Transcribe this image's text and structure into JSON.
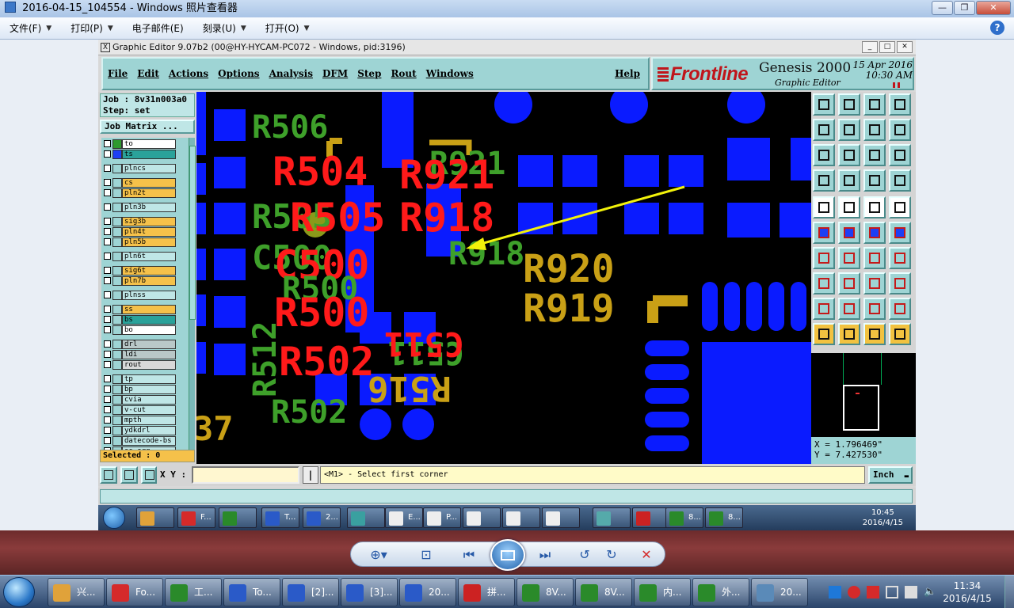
{
  "viewer": {
    "title": "2016-04-15_104554 - Windows 照片查看器",
    "menu": [
      {
        "label": "文件(F)"
      },
      {
        "label": "打印(P)"
      },
      {
        "label": "电子邮件(E)"
      },
      {
        "label": "刻录(U)"
      },
      {
        "label": "打开(O)"
      }
    ]
  },
  "editor": {
    "title": "Graphic Editor 9.07b2 (00@HY-HYCAM-PC072 - Windows, pid:3196)",
    "menu": [
      "File",
      "Edit",
      "Actions",
      "Options",
      "Analysis",
      "DFM",
      "Step",
      "Rout",
      "Windows"
    ],
    "help": "Help",
    "brand": {
      "logo": "Frontline",
      "product": "Genesis 2000",
      "subtitle": "Graphic Editor",
      "date": "15 Apr 2016",
      "time": "10:30 AM"
    },
    "job_line": "Job : 8v31n003a0",
    "step_line": "Step: set",
    "job_matrix": "Job Matrix ...",
    "layers": [
      {
        "name": "to",
        "swatch": "#2e9a2e",
        "bg": "#ffffff"
      },
      {
        "name": "ts",
        "swatch": "#1d3ff5",
        "bg": "#2aa29a"
      },
      {
        "name": "plncs",
        "swatch": "",
        "bg": "#bfe6e6"
      },
      {
        "name": "cs",
        "swatch": "",
        "bg": "#f5c14a"
      },
      {
        "name": "pln2t",
        "swatch": "",
        "bg": "#f5c14a"
      },
      {
        "name": "pln3b",
        "swatch": "",
        "bg": "#bfe6e6"
      },
      {
        "name": "sig3b",
        "swatch": "",
        "bg": "#f5c14a"
      },
      {
        "name": "pln4t",
        "swatch": "",
        "bg": "#f5c14a"
      },
      {
        "name": "pln5b",
        "swatch": "",
        "bg": "#f5c14a"
      },
      {
        "name": "pln6t",
        "swatch": "",
        "bg": "#bfe6e6"
      },
      {
        "name": "sig6t",
        "swatch": "",
        "bg": "#f5c14a"
      },
      {
        "name": "pln7b",
        "swatch": "",
        "bg": "#f5c14a"
      },
      {
        "name": "plnss",
        "swatch": "",
        "bg": "#bfe6e6"
      },
      {
        "name": "ss",
        "swatch": "",
        "bg": "#f5c14a"
      },
      {
        "name": "bs",
        "swatch": "",
        "bg": "#2aa29a"
      },
      {
        "name": "bo",
        "swatch": "",
        "bg": "#ffffff"
      },
      {
        "name": "drl",
        "swatch": "",
        "bg": "#b9c8c8"
      },
      {
        "name": "ldi",
        "swatch": "",
        "bg": "#b9c8c8"
      },
      {
        "name": "rout",
        "swatch": "",
        "bg": "#d8d8d8"
      },
      {
        "name": "tp",
        "swatch": "",
        "bg": "#bfe6e6"
      },
      {
        "name": "bp",
        "swatch": "",
        "bg": "#bfe6e6"
      },
      {
        "name": "cvia",
        "swatch": "",
        "bg": "#bfe6e6"
      },
      {
        "name": "v-cut",
        "swatch": "",
        "bg": "#bfe6e6"
      },
      {
        "name": "mpth",
        "swatch": "",
        "bg": "#bfe6e6"
      },
      {
        "name": "ydkdrl",
        "swatch": "",
        "bg": "#bfe6e6"
      },
      {
        "name": "datecode-bs",
        "swatch": "",
        "bg": "#bfe6e6"
      },
      {
        "name": "ss-org",
        "swatch": "",
        "bg": "#bfe6e6"
      }
    ],
    "selected": "Selected : 0",
    "coords": {
      "x": "X = 1.796469\"",
      "y": "Y = 7.427530\""
    },
    "xy_label": "X Y :",
    "xy_value": "",
    "prompt": "<M1> - Select first corner",
    "unit": "Inch",
    "canvas_labels": [
      {
        "text": "R506",
        "color": "#3ea02a"
      },
      {
        "text": "R504",
        "color": "#ff1a1a"
      },
      {
        "text": "R921",
        "color": "#3ea02a"
      },
      {
        "text": "R921",
        "color": "#ff1a1a"
      },
      {
        "text": "R505",
        "color": "#3ea02a"
      },
      {
        "text": "R505",
        "color": "#ff1a1a"
      },
      {
        "text": "R918",
        "color": "#ff1a1a"
      },
      {
        "text": "R918",
        "color": "#3ea02a"
      },
      {
        "text": "C500",
        "color": "#3ea02a"
      },
      {
        "text": "C500",
        "color": "#ff1a1a"
      },
      {
        "text": "R920",
        "color": "#c9a016"
      },
      {
        "text": "R500",
        "color": "#3ea02a"
      },
      {
        "text": "R500",
        "color": "#ff1a1a"
      },
      {
        "text": "R919",
        "color": "#c9a016"
      },
      {
        "text": "C511",
        "color": "#3ea02a"
      },
      {
        "text": "C511",
        "color": "#ff1a1a"
      },
      {
        "text": "R502",
        "color": "#ff1a1a"
      },
      {
        "text": "R516",
        "color": "#c9a016"
      },
      {
        "text": "R502",
        "color": "#3ea02a"
      },
      {
        "text": "R512",
        "color": "#3ea02a"
      },
      {
        "text": "37",
        "color": "#c9a016"
      }
    ],
    "taskbar": {
      "items": [
        "",
        "F...",
        "",
        "T...",
        "2...",
        "",
        "E...",
        "P...",
        "",
        "",
        "",
        "",
        "",
        "8...",
        "8..."
      ],
      "time": "10:45",
      "date": "2016/4/15"
    }
  },
  "taskbar": {
    "items": [
      "兴...",
      "Fo...",
      "工...",
      "To...",
      "[2]...",
      "[3]...",
      "20...",
      "拼...",
      "8V...",
      "8V...",
      "内...",
      "外...",
      "20..."
    ],
    "time": "11:34",
    "date": "2016/4/15"
  },
  "colors": {
    "pad": "#0a1bff",
    "teal": "#9ed4d4",
    "annotation_arrow": "#f2f20a"
  },
  "icons": [
    "zoom-icon",
    "actual-size-icon",
    "previous-icon",
    "slideshow-icon",
    "next-icon",
    "rotate-ccw-icon",
    "rotate-cw-icon",
    "delete-icon",
    "help-icon"
  ]
}
